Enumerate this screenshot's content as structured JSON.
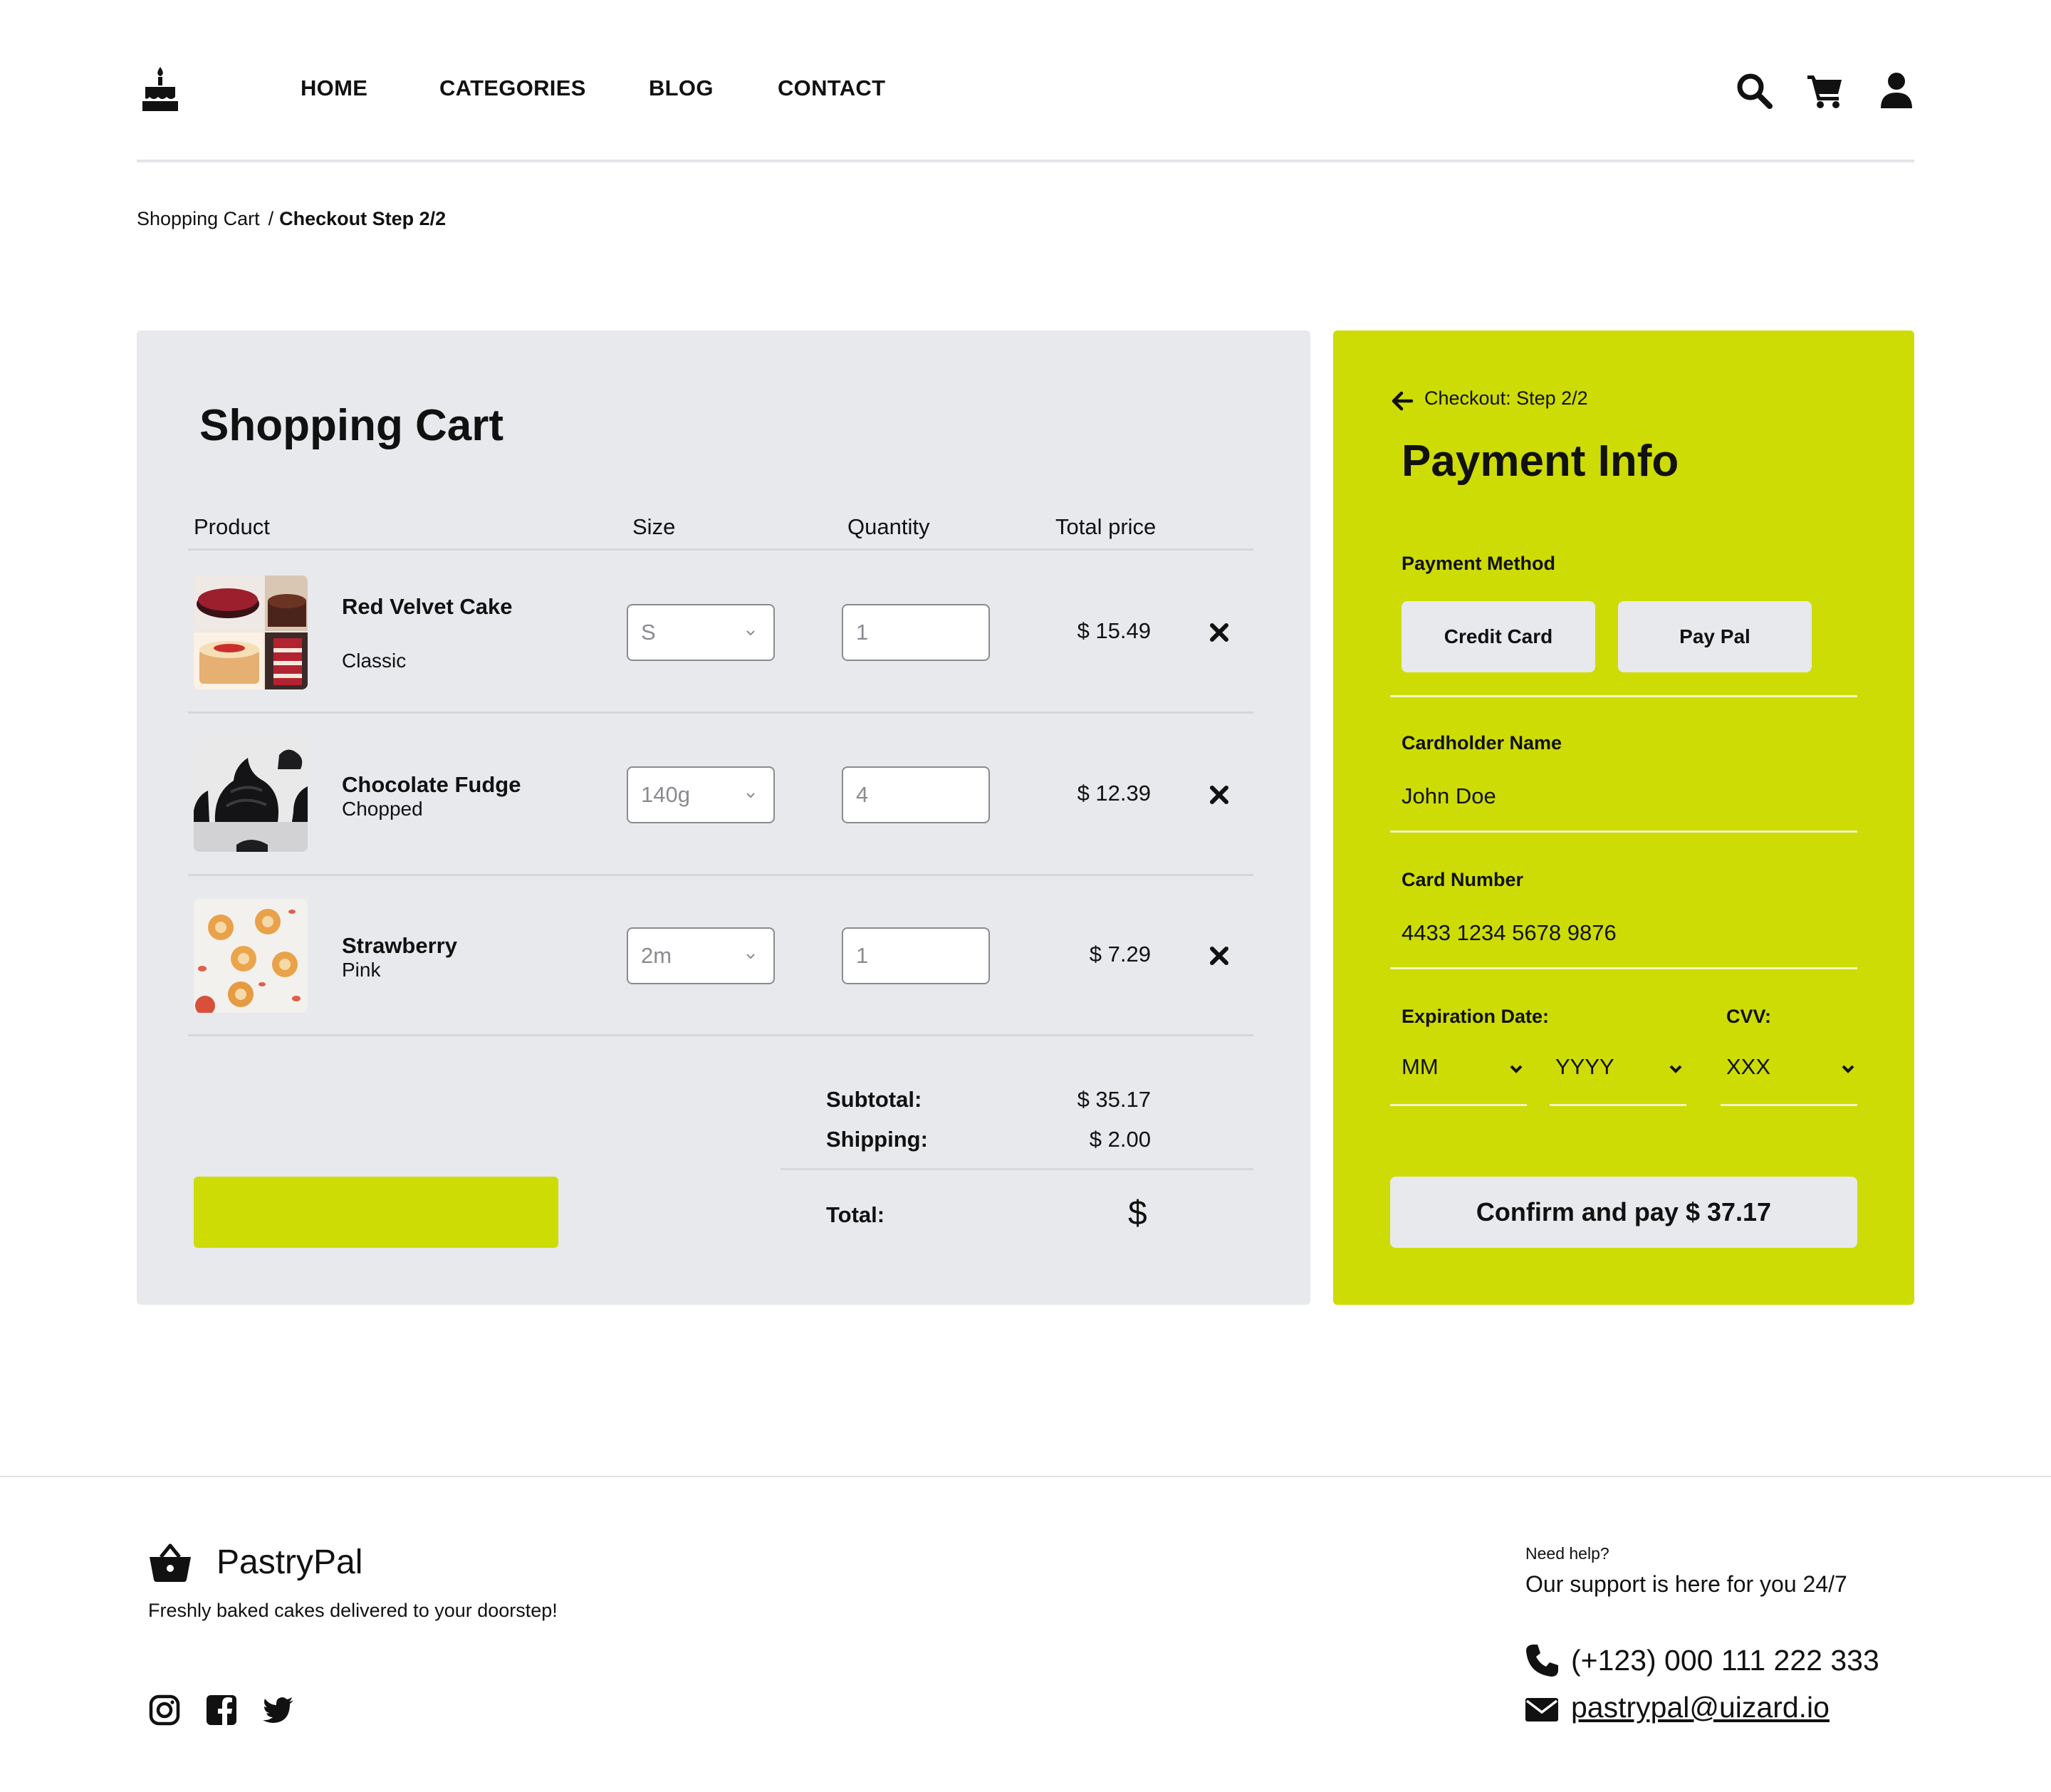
{
  "header": {
    "nav": [
      "HOME",
      "CATEGORIES",
      "BLOG",
      "CONTACT"
    ],
    "icons": [
      "cake-logo-icon",
      "search-icon",
      "cart-icon",
      "user-icon"
    ]
  },
  "breadcrumb": {
    "link": "Shopping Cart",
    "separator": "/",
    "current": "Checkout Step 2/2"
  },
  "cart": {
    "title": "Shopping Cart",
    "columns": {
      "product": "Product",
      "size": "Size",
      "quantity": "Quantity",
      "total": "Total price"
    },
    "items": [
      {
        "name": "Red Velvet Cake",
        "variant": "Classic",
        "size": "S",
        "quantity": "1",
        "price": "$ 15.49"
      },
      {
        "name": "Chocolate Fudge",
        "variant": "Chopped",
        "size": "140g",
        "quantity": "4",
        "price": "$ 12.39"
      },
      {
        "name": "Strawberry",
        "variant": "Pink",
        "size": "2m",
        "quantity": "1",
        "price": "$ 7.29"
      }
    ],
    "summary": {
      "subtotal_label": "Subtotal:",
      "subtotal_value": "$ 35.17",
      "shipping_label": "Shipping:",
      "shipping_value": "$ 2.00",
      "total_label": "Total:",
      "total_value": "$"
    }
  },
  "payment": {
    "step_label": "Checkout: Step 2/2",
    "title": "Payment Info",
    "method_label": "Payment Method",
    "methods": [
      "Credit Card",
      "Pay Pal"
    ],
    "cardholder_label": "Cardholder Name",
    "cardholder_value": "John Doe",
    "card_number_label": "Card Number",
    "card_number_value": "4433 1234 5678 9876",
    "expiration_label": "Expiration Date:",
    "cvv_label": "CVV:",
    "month_value": "MM",
    "year_value": "YYYY",
    "cvv_value": "XXX",
    "confirm_label": "Confirm and pay $ 37.17"
  },
  "footer": {
    "brand": "PastryPal",
    "tagline": "Freshly baked cakes delivered to your doorstep!",
    "help_label": "Need help?",
    "support_text": "Our support is here for you 24/7",
    "phone": "(+123) 000 111 222 333",
    "email": "pastrypal@uizard.io",
    "social": [
      "instagram-icon",
      "facebook-icon",
      "twitter-icon"
    ]
  },
  "colors": {
    "accent": "#cddc05",
    "panel": "#e8e9ec",
    "text": "#111111"
  }
}
